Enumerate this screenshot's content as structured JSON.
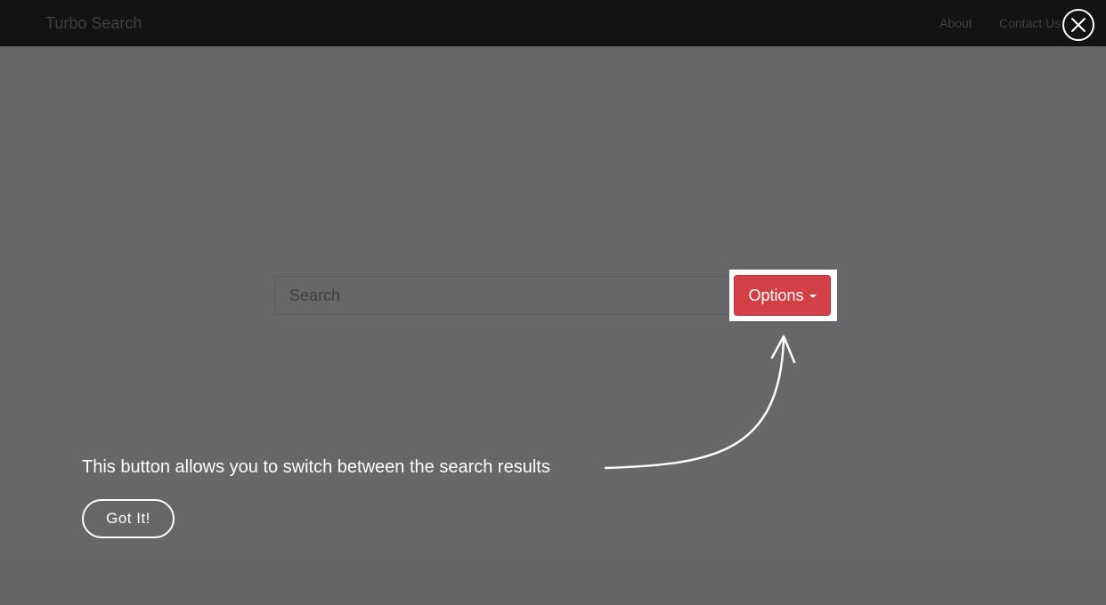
{
  "app": {
    "brand": "Turbo Search"
  },
  "nav": {
    "about": "About",
    "contact": "Contact Us"
  },
  "search": {
    "placeholder": "Search",
    "value": ""
  },
  "options_button": {
    "label": "Options"
  },
  "tour": {
    "message": "This button allows you to switch between the search results",
    "dismiss_label": "Got It!"
  },
  "icons": {
    "close": "close-icon",
    "options_caret": "caret-down-icon",
    "pointer": "curved-arrow-icon"
  },
  "colors": {
    "overlay": "#676668",
    "navbar": "#131313",
    "accent": "#d23f45",
    "highlight": "#ffffff",
    "tour_text": "#ffffff"
  }
}
